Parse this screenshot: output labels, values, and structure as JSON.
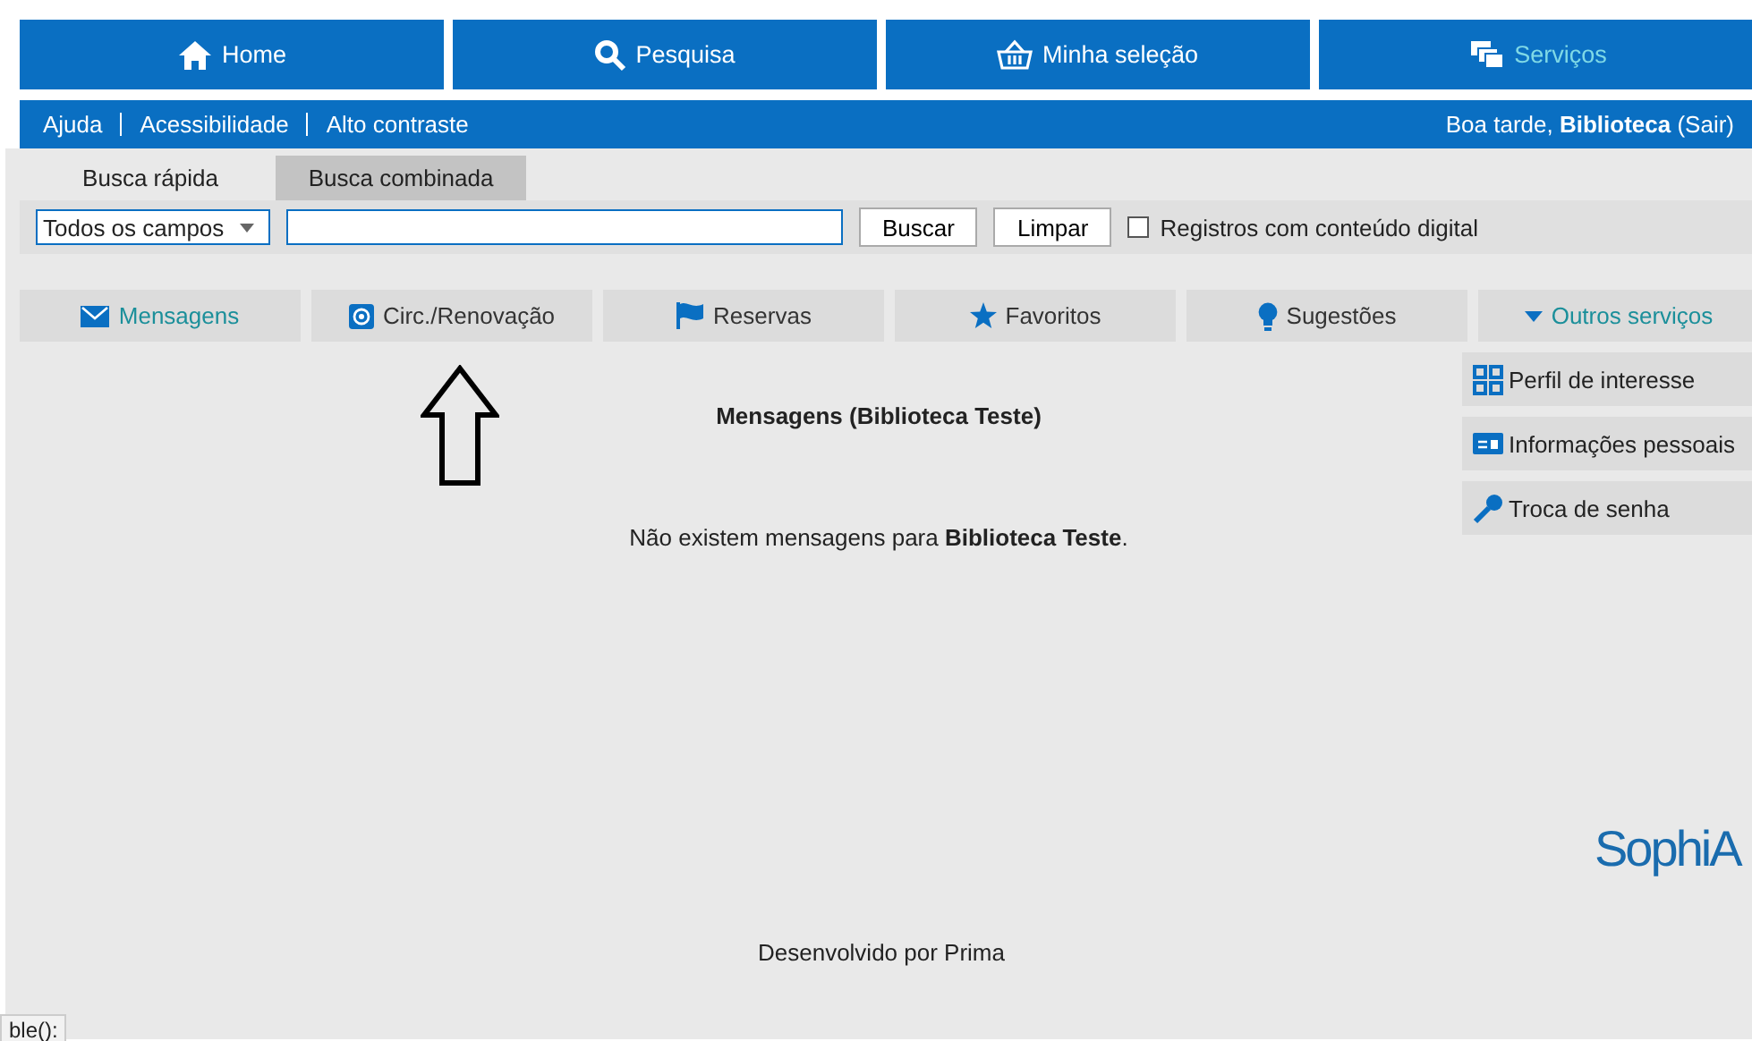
{
  "nav": [
    {
      "label": "Home",
      "selected": false
    },
    {
      "label": "Pesquisa",
      "selected": false
    },
    {
      "label": "Minha seleção",
      "selected": false
    },
    {
      "label": "Serviços",
      "selected": true
    }
  ],
  "top_bar": {
    "links": [
      "Ajuda",
      "Acessibilidade",
      "Alto contraste"
    ],
    "greeting": "Boa tarde, **Biblioteca** (Sair)"
  },
  "search_tabs": [
    {
      "label": "Busca rápida",
      "selected": true
    },
    {
      "label": "Busca combinada",
      "selected": false
    }
  ],
  "search": {
    "field_select": "Todos os campos",
    "buttons": [
      "Buscar",
      "Limpar"
    ],
    "checkbox": {
      "label": "Registros com conteúdo digital",
      "checked": false
    }
  },
  "service_tabs": [
    {
      "kind": "tab",
      "label": "Mensagens",
      "selected": true
    },
    {
      "kind": "tab",
      "label": "Circ./Renovação",
      "selected": false
    },
    {
      "kind": "tab",
      "label": "Reservas",
      "selected": false
    },
    {
      "kind": "tab",
      "label": "Favoritos",
      "selected": false
    },
    {
      "kind": "tab",
      "label": "Sugestões",
      "selected": false
    },
    {
      "kind": "dropdown",
      "label": "Outros serviços",
      "expanded": true
    }
  ],
  "menu": [
    {
      "label": "Perfil de interesse"
    },
    {
      "label": "Informações pessoais"
    },
    {
      "label": "Troca de senha"
    }
  ],
  "title": "Mensagens (Biblioteca Teste)",
  "message": "Não existem mensagens para **Biblioteca Teste**.",
  "logo": "SophiA",
  "footer": "Desenvolvido por Prima",
  "status": "ble():"
}
